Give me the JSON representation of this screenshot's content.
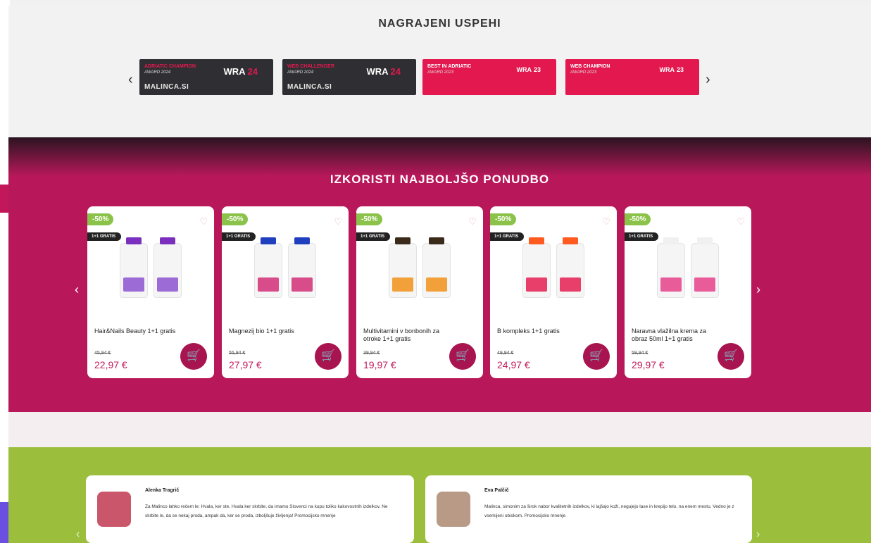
{
  "awards": {
    "title": "NAGRAJENI USPEHI",
    "prev_icon": "chevron-left-icon",
    "next_icon": "chevron-right-icon",
    "items": [
      {
        "title": "Adriatic Champion",
        "subtitle": "AWARD 2024",
        "site": "MALINCA.SI",
        "logo": "WRA",
        "logo_year": "24"
      },
      {
        "title": "Web Challenger",
        "subtitle": "AWARD 2024",
        "site": "MALINCA.SI",
        "logo": "WRA",
        "logo_year": "24"
      },
      {
        "title": "Best in Adriatic",
        "subtitle": "AWARD 2023",
        "site": "",
        "logo": "WRA",
        "logo_year": "23"
      },
      {
        "title": "Web Champion",
        "subtitle": "AWARD 2023",
        "site": "",
        "logo": "WRA",
        "logo_year": "23"
      }
    ]
  },
  "offer": {
    "title": "IZKORISTI NAJBOLJŠO PONUDBO",
    "prev_icon": "chevron-left-icon",
    "next_icon": "chevron-right-icon",
    "products": [
      {
        "discount": "-50%",
        "promo": "1+1 GRATIS",
        "name": "Hair&Nails Beauty 1+1 gratis",
        "old_price": "45,94 €",
        "price": "22,97 €",
        "cap_color": "#7b2fbf",
        "label_color": "#9c6bd6"
      },
      {
        "discount": "-50%",
        "promo": "1+1 GRATIS",
        "name": "Magnezij bio 1+1 gratis",
        "old_price": "55,94 €",
        "price": "27,97 €",
        "cap_color": "#1f3fbf",
        "label_color": "#d94c8a"
      },
      {
        "discount": "-50%",
        "promo": "1+1 GRATIS",
        "name": "Multivitamini v bonbonih za otroke 1+1 gratis",
        "old_price": "39,94 €",
        "price": "19,97 €",
        "cap_color": "#3a2a1a",
        "label_color": "#f2a03a"
      },
      {
        "discount": "-50%",
        "promo": "1+1 GRATIS",
        "name": "B kompleks 1+1 gratis",
        "old_price": "49,94 €",
        "price": "24,97 €",
        "cap_color": "#ff5a1f",
        "label_color": "#e83e6a"
      },
      {
        "discount": "-50%",
        "promo": "1+1 GRATIS",
        "name": "Naravna vlažilna krema za obraz 50ml 1+1 gratis",
        "old_price": "59,94 €",
        "price": "29,97 €",
        "cap_color": "#f0f0f0",
        "label_color": "#e85c9a"
      }
    ],
    "heart_icon": "heart-icon",
    "cart_icon": "cart-icon"
  },
  "reviews": {
    "items": [
      {
        "name": "Alenka Tragrič",
        "text": "Za Malinco lahko rečem le: Hvala, ker ste. Hvala ker skrbite, da imamo Slovenci na kupu toliko kakovostnih izdelkov. Ne skrbite le, da se nekaj proda, ampak da, ker se proda, izboljšuje življenja! Promocijsko mnenje",
        "avatar_color": "#c9566a"
      },
      {
        "name": "Eva Palčič",
        "text": "Malinca, simonim za širok nabor kvalitetnih izdelkov, ki lajšajo koži, negujejo lase in krepijo telo, na enem mestu. Vedno je z vsemijeni obiskom. Promocijsko mnenje",
        "avatar_color": "#b89a86"
      }
    ]
  }
}
